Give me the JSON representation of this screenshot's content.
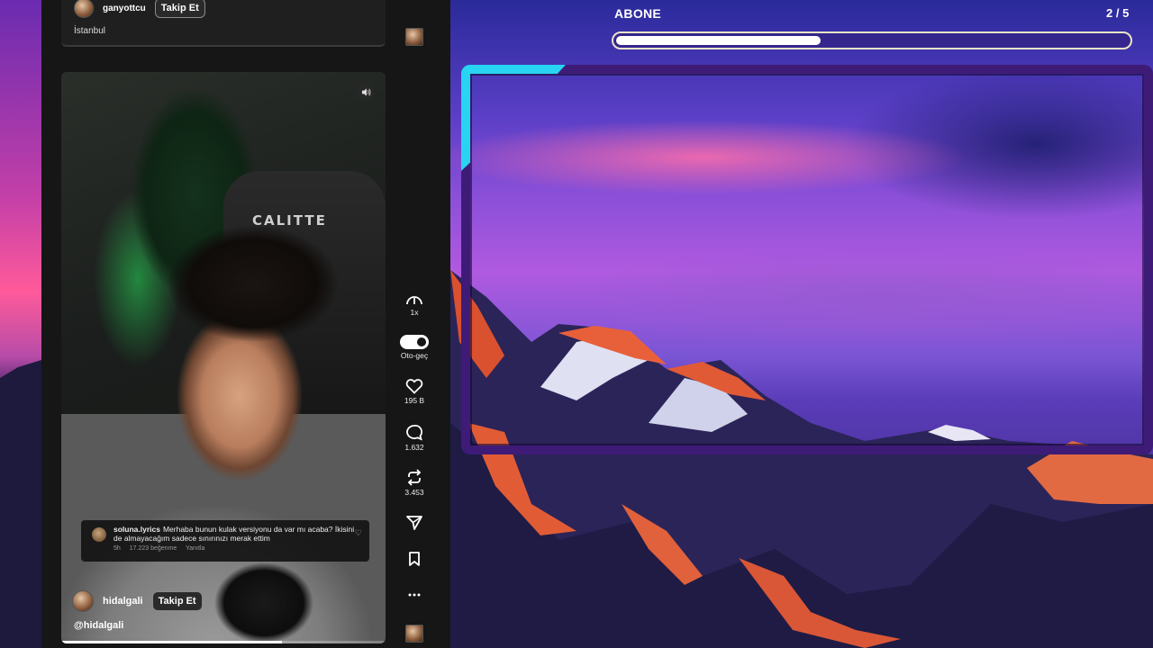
{
  "previous_post": {
    "username": "ganyottcu",
    "follow_label": "Takip Et",
    "location": "İstanbul"
  },
  "video": {
    "chair_brand": "CALITTE",
    "volume_icon": "volume-icon",
    "progress_fraction": 0.68
  },
  "comment": {
    "username": "soluna.lyrics",
    "text": "Merhaba bunun kulak versiyonu da var mı acaba? İkisini de almayacağım sadece sınırınızı merak ettim",
    "age": "5h",
    "likes": "17.223 beğenme",
    "reply": "Yanıtla"
  },
  "creator": {
    "username": "hidalgali",
    "follow_label": "Takip Et",
    "handle": "@hidalgali"
  },
  "rail": {
    "speed": "1x",
    "autoplay_label": "Oto-geç",
    "likes": "195 B",
    "comments": "1.632",
    "reposts": "3.453"
  },
  "goal": {
    "label": "ABONE",
    "count": "2 / 5",
    "progress_fraction": 0.4
  },
  "colors": {
    "panel_bg": "#161616",
    "frame": "#3f1b78",
    "frame_accent": "#29d3f2",
    "goal_border": "#e9e4c8"
  }
}
